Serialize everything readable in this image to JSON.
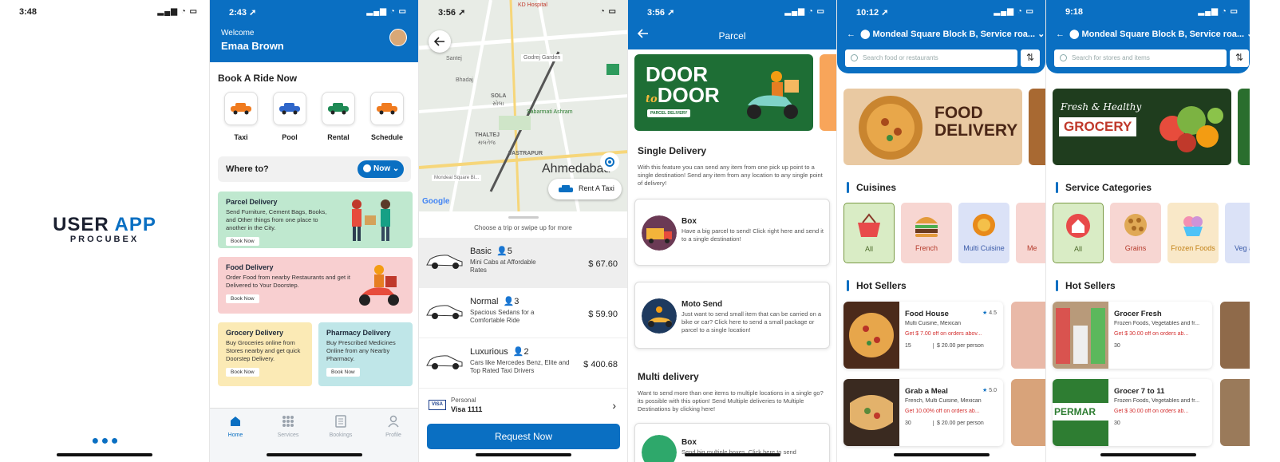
{
  "p1": {
    "time": "3:48",
    "title_a": "USER",
    "title_b": "APP",
    "brand": "PROCUBEX"
  },
  "p2": {
    "time": "2:43",
    "welcome": "Welcome",
    "name": "Emaa Brown",
    "section": "Book A Ride Now",
    "rides": [
      "Taxi",
      "Pool",
      "Rental",
      "Schedule"
    ],
    "where": "Where to?",
    "now": "Now",
    "cards": [
      {
        "title": "Parcel Delivery",
        "desc": "Send Furniture, Cement Bags, Books, and Other things from one place to another in the City.",
        "btn": "Book Now",
        "color": "#bfe8cf"
      },
      {
        "title": "Food Delivery",
        "desc": "Order Food from nearby Restaurants and get it Delivered to Your Doorstep.",
        "btn": "Book Now",
        "color": "#f8cfd0"
      },
      {
        "title": "Grocery Delivery",
        "desc": "Buy Groceries online from Stores nearby and get quick Doorstep Delivery.",
        "btn": "Book Now",
        "color": "#fbeab5"
      },
      {
        "title": "Pharmacy Delivery",
        "desc": "Buy Prescribed Medicines Online from any Nearby Pharmacy.",
        "btn": "Book Now",
        "color": "#bfe6e8"
      }
    ],
    "tabs": [
      "Home",
      "Services",
      "Bookings",
      "Profile"
    ]
  },
  "p3": {
    "time": "3:56",
    "map_labels": [
      "KD Hospital",
      "Godrej Garden",
      "Santej",
      "Bhadaj",
      "SOLA",
      "સોલા",
      "Sabarmati Ashram",
      "THALTEJ",
      "થલતેજ",
      "VASTRAPUR",
      "Ahmedabad",
      "Mondeal Square Bl...",
      "Google"
    ],
    "rent_taxi": "Rent A Taxi",
    "choose": "Choose a trip or swipe up for more",
    "trips": [
      {
        "name": "Basic",
        "seats": "5",
        "desc": "Mini Cabs at Affordable Rates",
        "price": "$ 67.60"
      },
      {
        "name": "Normal",
        "seats": "3",
        "desc": "Spacious Sedans for a Comfortable Ride",
        "price": "$ 59.90"
      },
      {
        "name": "Luxurious",
        "seats": "2",
        "desc": "Cars like Mercedes Benz, Elite and Top Rated Taxi Drivers",
        "price": "$ 400.68"
      }
    ],
    "pay_type": "Personal",
    "pay_card": "Visa 1111",
    "visa": "VISA",
    "request": "Request Now"
  },
  "p4": {
    "time": "3:56",
    "title": "Parcel",
    "banner_a": "DOOR",
    "banner_to": "to",
    "banner_b": "DOOR",
    "banner_sub": "PARCEL DELIVERY",
    "single_title": "Single Delivery",
    "single_desc": "With this feature you can send any item from one pick up point to a single destination! Send any item from any location to any single point of delivery!",
    "options": [
      {
        "title": "Box",
        "desc": "Have a big parcel to send! Click right here and send it to a single destination!"
      },
      {
        "title": "Moto Send",
        "desc": "Just want to send small item that can be carried on a bike or car? Click here to send a small package or parcel to a single location!"
      }
    ],
    "multi_title": "Multi delivery",
    "multi_desc": "Want to send more than one items to multiple locations in a single go? its possible with this option! Send Multiple deliveries to Multiple Destinations by clicking here!",
    "multi_box_title": "Box",
    "multi_box_desc": "Send big multiple boxes. Click here to send"
  },
  "p5": {
    "time": "10:12",
    "location": "Mondeal Square Block B, Service roa...",
    "search_placeholder": "Search food or restaurants",
    "banner_a": "FOOD",
    "banner_b": "DELIVERY",
    "cuisines_title": "Cuisines",
    "cuisines": [
      {
        "label": "All",
        "bg": "#d9ecc5"
      },
      {
        "label": "French",
        "bg": "#f7d6d2"
      },
      {
        "label": "Multi Cuisine",
        "bg": "#dbe2f7"
      },
      {
        "label": "Me",
        "bg": "#f7d6d2"
      }
    ],
    "hot_title": "Hot Sellers",
    "sellers": [
      {
        "name": "Food House",
        "rating": "4.5",
        "sub": "Multi Cuisine, Mexican",
        "offer": "Get $ 7.00 off on orders abov...",
        "time": "15",
        "price": "$ 20.00 per person"
      },
      {
        "name": "Grab a Meal",
        "rating": "5.0",
        "sub": "French, Multi Cuisine, Mexican",
        "offer": "Get 10.00% off on orders ab...",
        "time": "30",
        "price": "$ 20.00 per person"
      }
    ]
  },
  "p6": {
    "time": "9:18",
    "location": "Mondeal Square Block B, Service roa...",
    "search_placeholder": "Search for stores and items",
    "banner_a": "Fresh & Healthy",
    "banner_b": "GROCERY",
    "cat_title": "Service Categories",
    "cats": [
      {
        "label": "All",
        "bg": "#d9ecc5"
      },
      {
        "label": "Grains",
        "bg": "#f7d6d2"
      },
      {
        "label": "Frozen Foods",
        "bg": "#f9e8c8"
      },
      {
        "label": "Veg an",
        "bg": "#dbe2f7"
      }
    ],
    "hot_title": "Hot Sellers",
    "sellers": [
      {
        "name": "Grocer Fresh",
        "sub": "Frozen Foods, Vegetables and fr...",
        "offer": "Get $ 30.00 off on orders ab...",
        "time": "30"
      },
      {
        "name": "Grocer 7 to 11",
        "sub": "Frozen Foods, Vegetables and fr...",
        "offer": "Get $ 30.00 off on orders ab...",
        "time": "30",
        "tag": "PERMAR"
      }
    ]
  }
}
